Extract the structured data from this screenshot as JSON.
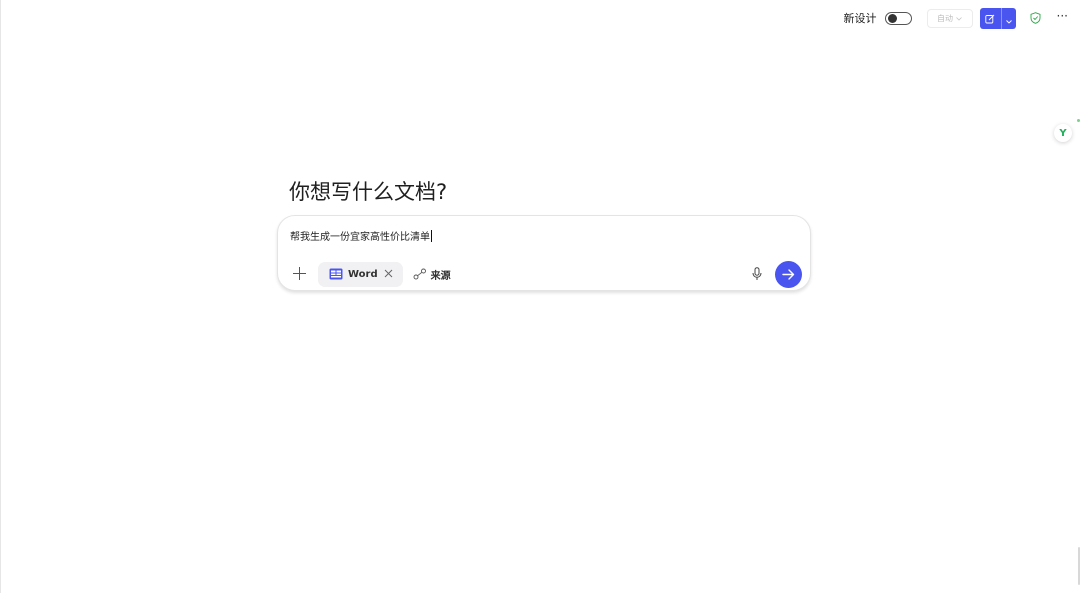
{
  "toolbar": {
    "new_design_label": "新设计",
    "auto_label": "自动",
    "accent": "#4a55f0",
    "more_label": "···"
  },
  "side_badge": {
    "letter": "Y",
    "color": "#1fb15a"
  },
  "main": {
    "heading": "你想写什么文档?",
    "prompt_text": "帮我生成一份宜家高性价比清单",
    "doc_type_chip": "Word",
    "source_label": "来源"
  },
  "icons": [
    "toggle-icon",
    "edit-icon",
    "chevron-down-icon",
    "shield-check-icon",
    "more-icon",
    "plus-icon",
    "word-icon",
    "close-icon",
    "link-icon",
    "microphone-icon",
    "arrow-right-icon"
  ]
}
